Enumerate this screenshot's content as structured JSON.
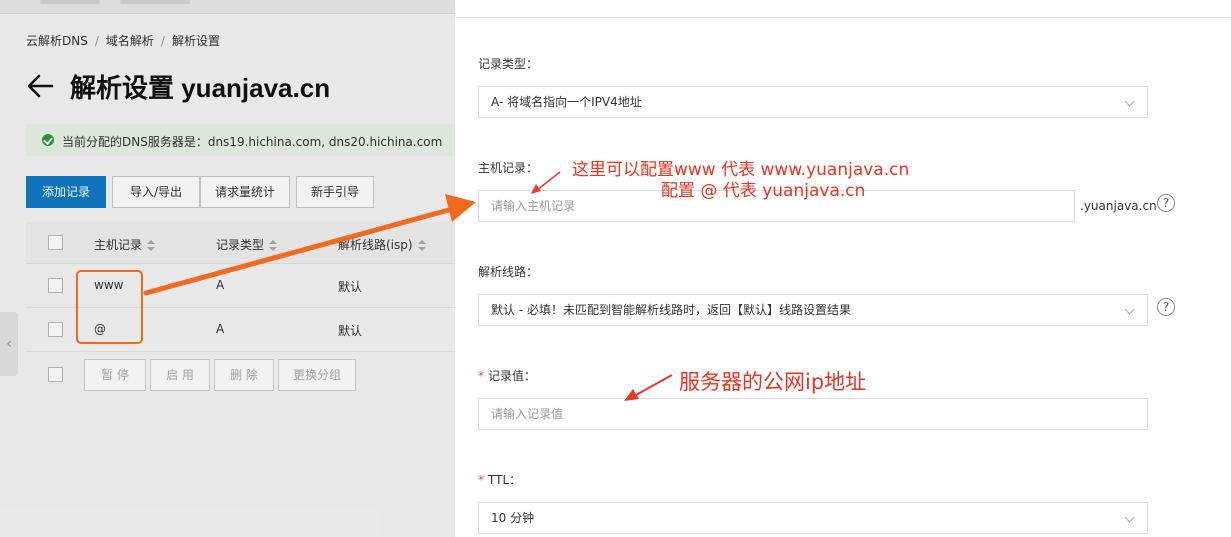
{
  "breadcrumb": [
    "云解析DNS",
    "域名解析",
    "解析设置"
  ],
  "page_title": "解析设置 yuanjava.cn",
  "notice": "当前分配的DNS服务器是：dns19.hichina.com, dns20.hichina.com",
  "toolbar": {
    "add_record": "添加记录",
    "import_export": "导入/导出",
    "request_stats": "请求量统计",
    "beginner_guide": "新手引导"
  },
  "table": {
    "columns": [
      "主机记录",
      "记录类型",
      "解析线路(isp)"
    ],
    "rows": [
      {
        "host": "www",
        "type": "A",
        "line": "默认"
      },
      {
        "host": "@",
        "type": "A",
        "line": "默认"
      }
    ]
  },
  "batch": {
    "pause": "暂 停",
    "enable": "启 用",
    "delete": "删 除",
    "change_group": "更换分组"
  },
  "form": {
    "record_type_label": "记录类型：",
    "record_type_value": "A- 将域名指向一个IPV4地址",
    "host_label": "主机记录：",
    "host_placeholder": "请输入主机记录",
    "host_suffix": ".yuanjava.cn",
    "line_label": "解析线路：",
    "line_value": "默认 - 必填！未匹配到智能解析线路时，返回【默认】线路设置结果",
    "value_label": "记录值：",
    "value_placeholder": "请输入记录值",
    "ttl_label": "TTL：",
    "ttl_value": "10 分钟",
    "help_glyph": "?"
  },
  "annotations": {
    "host_note_line1": "这里可以配置www  代表 www.yuanjava.cn",
    "host_note_line2": "配置 @    代表 yuanjava.cn",
    "value_note": "服务器的公网ip地址"
  },
  "colors": {
    "primary": "#0f7ac4",
    "annotation": "#ea3323",
    "arrow": "#f26a1f",
    "required": "#e64340",
    "success": "#2d9b3a"
  }
}
